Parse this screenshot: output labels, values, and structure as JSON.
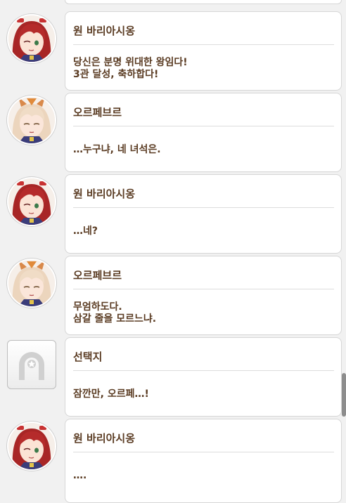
{
  "messages": [
    {
      "speaker": "원 바리아시옹",
      "avatar": "winvariation-avatar",
      "lines": [
        "당신은 분명 위대한 왕임다!",
        "3관 달성, 축하합다!"
      ]
    },
    {
      "speaker": "오르페브르",
      "avatar": "orfevre-avatar",
      "lines": [
        "…누구냐, 네 녀석은."
      ]
    },
    {
      "speaker": "원 바리아시옹",
      "avatar": "winvariation-avatar",
      "lines": [
        "…네?"
      ]
    },
    {
      "speaker": "오르페브르",
      "avatar": "orfevre-avatar",
      "lines": [
        "무엄하도다.",
        "삼갈 줄을 모르느냐."
      ]
    },
    {
      "speaker": "선택지",
      "avatar": "choice-horseshoe-icon",
      "lines": [
        "잠깐만, 오르페…!"
      ]
    },
    {
      "speaker": "원 바리아시옹",
      "avatar": "winvariation-avatar",
      "lines": [
        "…."
      ]
    }
  ],
  "colors": {
    "text": "#5a3b22",
    "bubble_bg": "#ffffff",
    "page_bg": "#f1f1f1",
    "winvariation_hair": "#b02a2a",
    "orfevre_hair": "#efd8c2",
    "ribbon": "#c83232"
  },
  "scrollbar": {
    "position_fraction": 0.86
  }
}
